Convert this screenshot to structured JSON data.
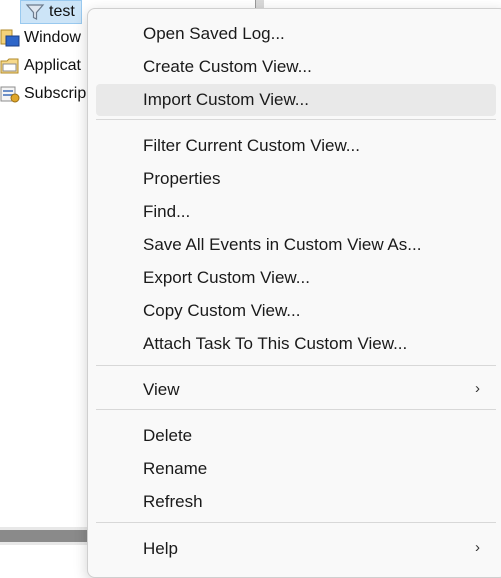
{
  "tree": {
    "selected_label": "test",
    "items": [
      {
        "label": "Window",
        "icon": "windows-logs-icon"
      },
      {
        "label": "Applicat",
        "icon": "applications-logs-folder-icon"
      },
      {
        "label": "Subscrip",
        "icon": "subscriptions-icon"
      }
    ]
  },
  "menu": {
    "items": {
      "open_saved_log": "Open Saved Log...",
      "create_custom_view": "Create Custom View...",
      "import_custom_view": "Import Custom View...",
      "filter_current_custom_view": "Filter Current Custom View...",
      "properties": "Properties",
      "find": "Find...",
      "save_all_events": "Save All Events in Custom View As...",
      "export_custom_view": "Export Custom View...",
      "copy_custom_view": "Copy Custom View...",
      "attach_task": "Attach Task To This Custom View...",
      "view": "View",
      "delete": "Delete",
      "rename": "Rename",
      "refresh": "Refresh",
      "help": "Help"
    },
    "submenu_arrow": "›",
    "highlighted_item": "Import Custom View..."
  },
  "colors": {
    "menu_background": "#f9f9f9",
    "hover_background": "#e9e9e9",
    "selection_background": "#cce4f7",
    "separator": "#d8d8d8"
  }
}
